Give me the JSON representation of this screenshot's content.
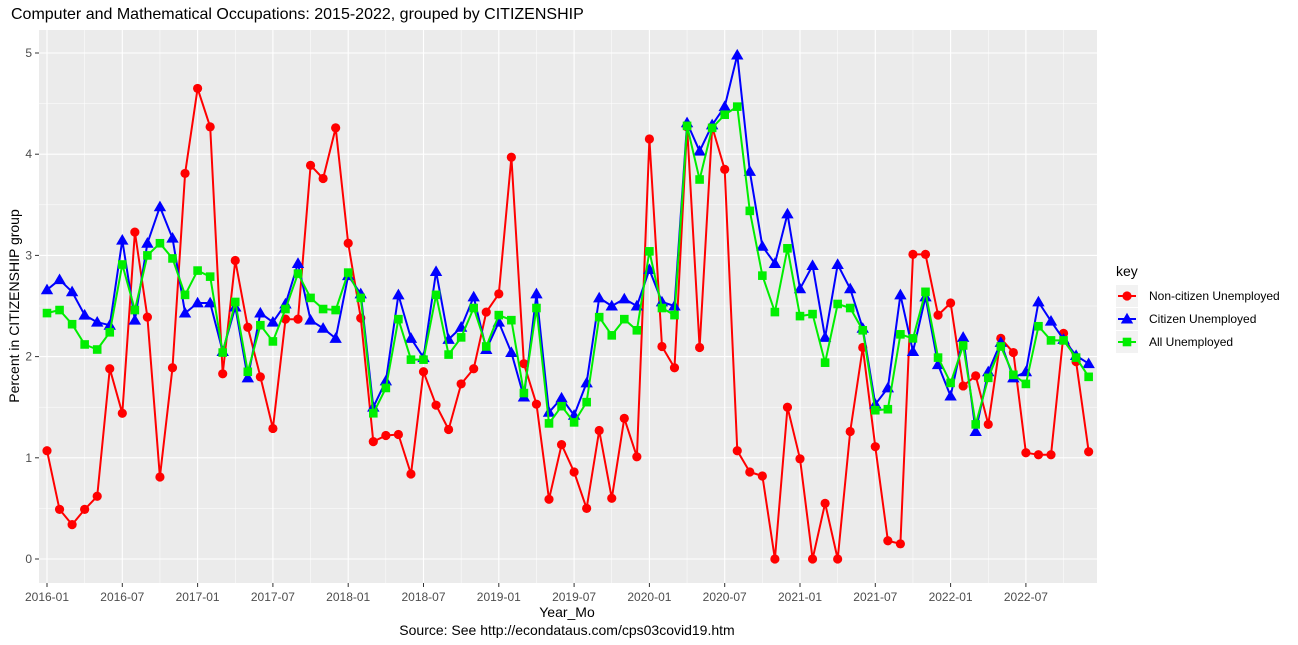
{
  "chart_data": {
    "type": "line",
    "title": "Computer and Mathematical Occupations: 2015-2022, grouped by CITIZENSHIP",
    "xlabel": "Year_Mo",
    "caption": "Source: See http://econdataus.com/cps03covid19.htm",
    "ylabel": "Percent in CITIZENSHIP group",
    "ylim": [
      -0.2,
      5.2
    ],
    "yticks": [
      0,
      1,
      2,
      3,
      4,
      5
    ],
    "xticks": [
      "2016-01",
      "2016-07",
      "2017-01",
      "2017-07",
      "2018-01",
      "2018-07",
      "2019-01",
      "2019-07",
      "2020-01",
      "2020-07",
      "2021-01",
      "2021-07",
      "2022-01",
      "2022-07"
    ],
    "x_start": "2016-01",
    "x_count_months": 84,
    "grid": true,
    "legend": {
      "title": "key",
      "position": "right"
    },
    "series": [
      {
        "name": "Non-citizen Unemployed",
        "color": "#ff0000",
        "marker": "circle",
        "values": [
          1.07,
          0.49,
          0.34,
          0.49,
          0.62,
          1.88,
          1.44,
          3.23,
          2.39,
          0.81,
          1.89,
          3.81,
          4.65,
          4.27,
          1.83,
          2.95,
          2.29,
          1.8,
          1.29,
          2.37,
          2.37,
          3.89,
          3.76,
          4.26,
          3.12,
          2.38,
          1.16,
          1.22,
          1.23,
          0.84,
          1.85,
          1.52,
          1.28,
          1.73,
          1.88,
          2.44,
          2.62,
          3.97,
          1.93,
          1.53,
          0.59,
          1.13,
          0.86,
          0.5,
          1.27,
          0.6,
          1.39,
          1.01,
          4.15,
          2.1,
          1.89,
          4.27,
          2.09,
          4.27,
          3.85,
          1.07,
          0.86,
          0.82,
          0.0,
          1.5,
          0.99,
          0.0,
          0.55,
          0.0,
          1.26,
          2.09,
          1.11,
          0.18,
          0.15,
          3.01,
          3.01,
          2.41,
          2.53,
          1.71,
          1.81,
          1.33,
          2.18,
          2.04,
          1.05,
          1.03,
          1.03,
          2.23,
          1.95,
          1.06
        ]
      },
      {
        "name": "Citizen Unemployed",
        "color": "#0000ff",
        "marker": "triangle",
        "values": [
          2.66,
          2.76,
          2.64,
          2.41,
          2.34,
          2.31,
          3.15,
          2.36,
          3.12,
          3.48,
          3.17,
          2.43,
          2.53,
          2.53,
          2.05,
          2.49,
          1.79,
          2.43,
          2.34,
          2.52,
          2.92,
          2.36,
          2.28,
          2.18,
          2.8,
          2.62,
          1.5,
          1.76,
          2.61,
          2.18,
          1.99,
          2.84,
          2.17,
          2.29,
          2.59,
          2.07,
          2.34,
          2.04,
          1.6,
          2.62,
          1.45,
          1.59,
          1.42,
          1.74,
          2.58,
          2.5,
          2.57,
          2.5,
          2.86,
          2.54,
          2.5,
          4.31,
          4.03,
          4.29,
          4.47,
          4.98,
          3.83,
          3.09,
          2.92,
          3.41,
          2.67,
          2.9,
          2.19,
          2.91,
          2.67,
          2.28,
          1.53,
          1.69,
          2.61,
          2.05,
          2.59,
          1.92,
          1.61,
          2.19,
          1.26,
          1.85,
          2.14,
          1.79,
          1.85,
          2.54,
          2.35,
          2.17,
          2.01,
          1.93
        ]
      },
      {
        "name": "All Unemployed",
        "color": "#00ee00",
        "marker": "square",
        "values": [
          2.43,
          2.46,
          2.32,
          2.12,
          2.07,
          2.24,
          2.91,
          2.46,
          3.0,
          3.12,
          2.97,
          2.61,
          2.85,
          2.79,
          2.04,
          2.54,
          1.85,
          2.31,
          2.15,
          2.47,
          2.82,
          2.58,
          2.47,
          2.46,
          2.83,
          2.58,
          1.44,
          1.69,
          2.37,
          1.97,
          1.97,
          2.61,
          2.02,
          2.19,
          2.48,
          2.1,
          2.41,
          2.36,
          1.64,
          2.48,
          1.34,
          1.51,
          1.35,
          1.55,
          2.39,
          2.21,
          2.37,
          2.26,
          3.04,
          2.48,
          2.41,
          4.28,
          3.75,
          4.26,
          4.39,
          4.47,
          3.44,
          2.8,
          2.44,
          3.07,
          2.4,
          2.42,
          1.94,
          2.52,
          2.48,
          2.26,
          1.47,
          1.48,
          2.22,
          2.18,
          2.64,
          1.99,
          1.74,
          2.11,
          1.33,
          1.79,
          2.1,
          1.82,
          1.73,
          2.3,
          2.16,
          2.16,
          1.99,
          1.8
        ]
      }
    ]
  }
}
